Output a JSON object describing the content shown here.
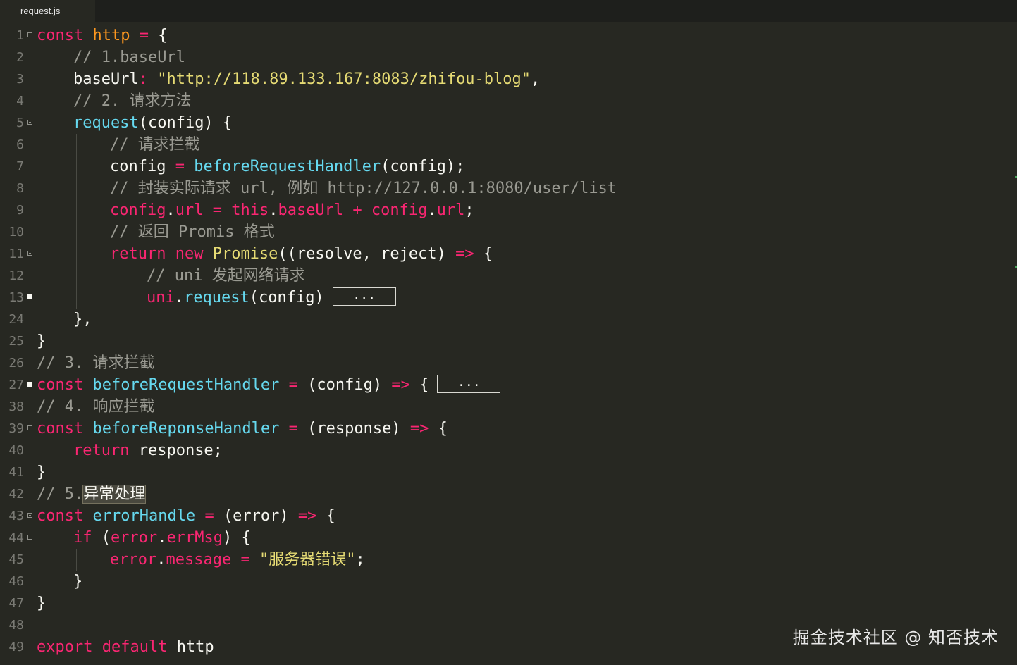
{
  "tab": {
    "filename": "request.js"
  },
  "collapsed_marker": "...",
  "watermark": "掘金技术社区 @ 知否技术",
  "lines": [
    {
      "n": "1",
      "fold": "minus",
      "tokens": [
        [
          "kw",
          "const "
        ],
        [
          "kw2",
          "http "
        ],
        [
          "op",
          "= "
        ],
        [
          "plain",
          "{"
        ]
      ]
    },
    {
      "n": "2",
      "indent": 1,
      "tokens": [
        [
          "cm",
          "// 1.baseUrl"
        ]
      ]
    },
    {
      "n": "3",
      "indent": 1,
      "tokens": [
        [
          "plain",
          "baseUrl"
        ],
        [
          "op",
          ": "
        ],
        [
          "str",
          "\"http://118.89.133.167:8083/zhifou-blog\""
        ],
        [
          "plain",
          ","
        ]
      ]
    },
    {
      "n": "4",
      "indent": 1,
      "tokens": [
        [
          "cm",
          "// 2. 请求方法"
        ]
      ]
    },
    {
      "n": "5",
      "fold": "minus",
      "indent": 1,
      "tokens": [
        [
          "fn",
          "request"
        ],
        [
          "plain",
          "(config) {"
        ]
      ]
    },
    {
      "n": "6",
      "indent": 2,
      "tokens": [
        [
          "cm",
          "// 请求拦截"
        ]
      ]
    },
    {
      "n": "7",
      "indent": 2,
      "tokens": [
        [
          "plain",
          "config "
        ],
        [
          "op",
          "= "
        ],
        [
          "fn",
          "beforeRequestHandler"
        ],
        [
          "plain",
          "(config);"
        ]
      ]
    },
    {
      "n": "8",
      "indent": 2,
      "tokens": [
        [
          "cm",
          "// 封装实际请求 url, 例如 http://127.0.0.1:8080/user/list"
        ]
      ]
    },
    {
      "n": "9",
      "indent": 2,
      "tokens": [
        [
          "prop",
          "config"
        ],
        [
          "plain",
          "."
        ],
        [
          "prop",
          "url "
        ],
        [
          "op",
          "= "
        ],
        [
          "kw",
          "this"
        ],
        [
          "plain",
          "."
        ],
        [
          "prop",
          "baseUrl "
        ],
        [
          "op",
          "+ "
        ],
        [
          "prop",
          "config"
        ],
        [
          "plain",
          "."
        ],
        [
          "prop",
          "url"
        ],
        [
          "plain",
          ";"
        ]
      ]
    },
    {
      "n": "10",
      "indent": 2,
      "tokens": [
        [
          "cm",
          "// 返回 Promis 格式"
        ]
      ]
    },
    {
      "n": "11",
      "fold": "minus",
      "indent": 2,
      "tokens": [
        [
          "kw",
          "return "
        ],
        [
          "kw",
          "new "
        ],
        [
          "cls",
          "Promise"
        ],
        [
          "plain",
          "((resolve, reject) "
        ],
        [
          "op",
          "=> "
        ],
        [
          "plain",
          "{"
        ]
      ]
    },
    {
      "n": "12",
      "indent": 3,
      "tokens": [
        [
          "cm",
          "// uni 发起网络请求"
        ]
      ]
    },
    {
      "n": "13",
      "fold": "plus",
      "indent": 3,
      "collapsed": true,
      "tokens": [
        [
          "prop",
          "uni"
        ],
        [
          "plain",
          "."
        ],
        [
          "fn",
          "request"
        ],
        [
          "plain",
          "(config)"
        ]
      ]
    },
    {
      "n": "24",
      "indent": 1,
      "tokens": [
        [
          "plain",
          "},"
        ]
      ]
    },
    {
      "n": "25",
      "tokens": [
        [
          "plain",
          "}"
        ]
      ]
    },
    {
      "n": "26",
      "tokens": [
        [
          "cm",
          "// 3. 请求拦截"
        ]
      ]
    },
    {
      "n": "27",
      "fold": "plus",
      "collapsed": true,
      "tokens": [
        [
          "kw",
          "const "
        ],
        [
          "fn",
          "beforeRequestHandler "
        ],
        [
          "op",
          "= "
        ],
        [
          "plain",
          "(config) "
        ],
        [
          "op",
          "=> "
        ],
        [
          "plain",
          "{"
        ]
      ]
    },
    {
      "n": "38",
      "tokens": [
        [
          "cm",
          "// 4. 响应拦截"
        ]
      ]
    },
    {
      "n": "39",
      "fold": "minus",
      "tokens": [
        [
          "kw",
          "const "
        ],
        [
          "fn",
          "beforeReponseHandler "
        ],
        [
          "op",
          "= "
        ],
        [
          "plain",
          "(response) "
        ],
        [
          "op",
          "=> "
        ],
        [
          "plain",
          "{"
        ]
      ]
    },
    {
      "n": "40",
      "indent": 1,
      "tokens": [
        [
          "kw",
          "return "
        ],
        [
          "plain",
          "response;"
        ]
      ]
    },
    {
      "n": "41",
      "tokens": [
        [
          "plain",
          "}"
        ]
      ]
    },
    {
      "n": "42",
      "tokens": [
        [
          "cm",
          "// 5."
        ],
        [
          "sel",
          "异常处理"
        ]
      ]
    },
    {
      "n": "43",
      "fold": "minus",
      "tokens": [
        [
          "kw",
          "const "
        ],
        [
          "fn",
          "errorHandle "
        ],
        [
          "op",
          "= "
        ],
        [
          "plain",
          "(error) "
        ],
        [
          "op",
          "=> "
        ],
        [
          "plain",
          "{"
        ]
      ]
    },
    {
      "n": "44",
      "fold": "minus",
      "indent": 1,
      "tokens": [
        [
          "kw",
          "if "
        ],
        [
          "plain",
          "("
        ],
        [
          "prop",
          "error"
        ],
        [
          "plain",
          "."
        ],
        [
          "prop",
          "errMsg"
        ],
        [
          "plain",
          ") {"
        ]
      ]
    },
    {
      "n": "45",
      "indent": 2,
      "tokens": [
        [
          "prop",
          "error"
        ],
        [
          "plain",
          "."
        ],
        [
          "prop",
          "message "
        ],
        [
          "op",
          "= "
        ],
        [
          "str",
          "\"服务器错误\""
        ],
        [
          "plain",
          ";"
        ]
      ]
    },
    {
      "n": "46",
      "indent": 1,
      "tokens": [
        [
          "plain",
          "}"
        ]
      ]
    },
    {
      "n": "47",
      "tokens": [
        [
          "plain",
          "}"
        ]
      ]
    },
    {
      "n": "48",
      "tokens": []
    },
    {
      "n": "49",
      "tokens": [
        [
          "kw",
          "export "
        ],
        [
          "kw",
          "default "
        ],
        [
          "plain",
          "http"
        ]
      ]
    }
  ]
}
